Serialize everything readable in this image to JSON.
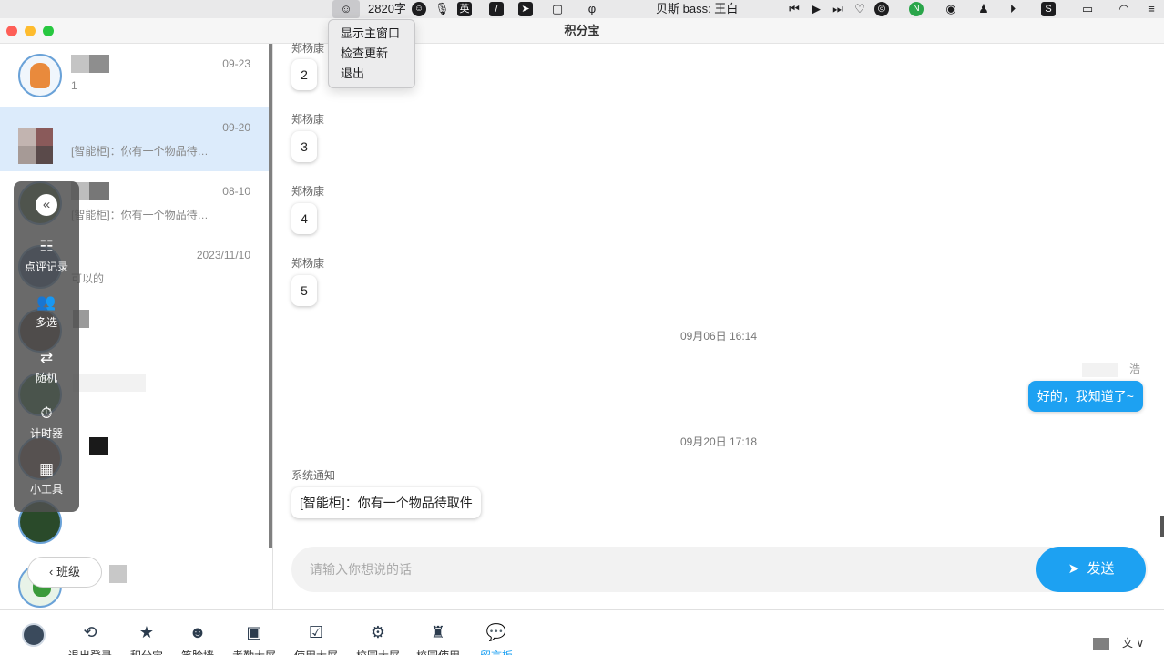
{
  "menubar": {
    "word_count": "2820字",
    "ime": "英",
    "now_playing": "贝斯 bass: 王白"
  },
  "dropdown": {
    "items": [
      "显示主窗口",
      "检查更新",
      "退出"
    ]
  },
  "window": {
    "title": "积分宝"
  },
  "conversations": [
    {
      "date": "09-23",
      "preview": "1",
      "active": false
    },
    {
      "date": "09-20",
      "preview": "[智能柜]：你有一个物品待…",
      "active": true
    },
    {
      "date": "08-10",
      "preview": "[智能柜]：你有一个物品待…",
      "active": false
    },
    {
      "date": "2023/11/10",
      "preview": "可以的",
      "active": false
    }
  ],
  "toolpanel": {
    "collapse": "«",
    "tools": [
      {
        "label": "点评记录",
        "icon": "comment-record-icon"
      },
      {
        "label": "多选",
        "icon": "multi-user-icon"
      },
      {
        "label": "随机",
        "icon": "shuffle-icon"
      },
      {
        "label": "计时器",
        "icon": "timer-icon"
      },
      {
        "label": "小工具",
        "icon": "widgets-icon"
      }
    ]
  },
  "class_button": {
    "label": "班级"
  },
  "chat": {
    "messages_in": [
      {
        "sender": "郑杨康",
        "text": "2"
      },
      {
        "sender": "郑杨康",
        "text": "3"
      },
      {
        "sender": "郑杨康",
        "text": "4"
      },
      {
        "sender": "郑杨康",
        "text": "5"
      }
    ],
    "timestamp_1": "09月06日 16:14",
    "self_name_suffix": "浩",
    "reply": "好的，我知道了~",
    "timestamp_2": "09月20日 17:18",
    "system_sender": "系统通知",
    "system_message": "[智能柜]：你有一个物品待取件",
    "input_placeholder": "请输入你想说的话",
    "send_label": "发送"
  },
  "bottombar": {
    "items": [
      {
        "label": "退出登录",
        "icon": "logout-icon"
      },
      {
        "label": "积分宝",
        "icon": "star-icon"
      },
      {
        "label": "笑脸墙",
        "icon": "smile-icon"
      },
      {
        "label": "考勤大屏",
        "icon": "calendar-icon"
      },
      {
        "label": "使用大屏",
        "icon": "check-calendar-icon"
      },
      {
        "label": "校园大屏",
        "icon": "robot-icon"
      },
      {
        "label": "校园使用",
        "icon": "badge-icon"
      },
      {
        "label": "留言板",
        "icon": "chat-icon",
        "active": true
      }
    ],
    "lang": "文"
  },
  "colors": {
    "accent": "#1da1f2",
    "active_row": "#dcebfb"
  }
}
